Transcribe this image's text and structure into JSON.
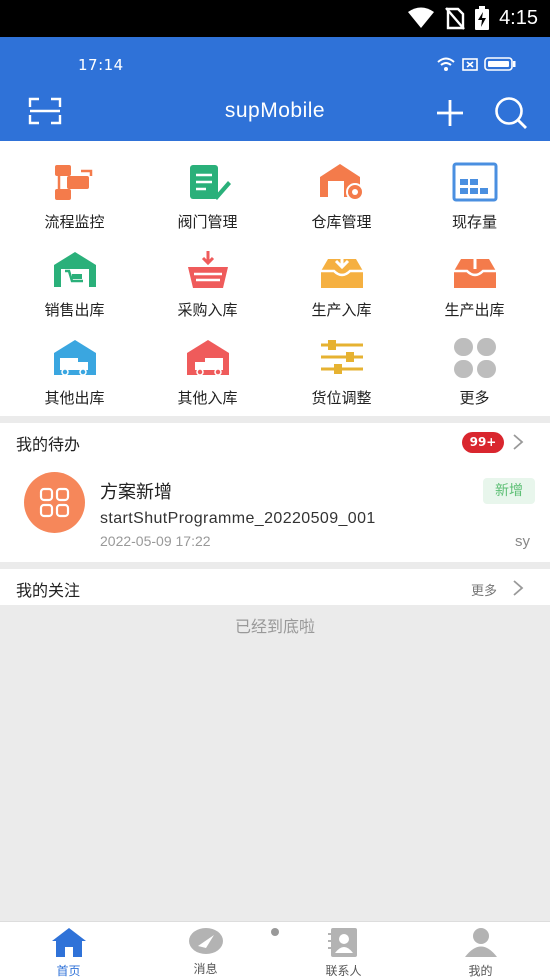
{
  "system": {
    "time": "4:15"
  },
  "app": {
    "inner_time": "17:14",
    "title": "supMobile",
    "icons": {
      "left": "scan-icon",
      "plus": "plus-icon",
      "search": "search-icon"
    }
  },
  "grid": {
    "items": [
      {
        "label": "流程监控",
        "icon": "process-monitor-icon",
        "color": "#f47b4b"
      },
      {
        "label": "阀门管理",
        "icon": "valve-manage-icon",
        "color": "#2ab07a"
      },
      {
        "label": "仓库管理",
        "icon": "warehouse-manage-icon",
        "color": "#f47b4b"
      },
      {
        "label": "现存量",
        "icon": "stock-icon",
        "color": "#4a8fe0"
      },
      {
        "label": "销售出库",
        "icon": "sales-out-icon",
        "color": "#2ab07a"
      },
      {
        "label": "采购入库",
        "icon": "purchase-in-icon",
        "color": "#ef5b5b"
      },
      {
        "label": "生产入库",
        "icon": "production-in-icon",
        "color": "#f5b041"
      },
      {
        "label": "生产出库",
        "icon": "production-out-icon",
        "color": "#f47b4b"
      },
      {
        "label": "其他出库",
        "icon": "other-out-icon",
        "color": "#3aa6e0"
      },
      {
        "label": "其他入库",
        "icon": "other-in-icon",
        "color": "#ef5b5b"
      },
      {
        "label": "货位调整",
        "icon": "location-adjust-icon",
        "color": "#e6b231"
      },
      {
        "label": "更多",
        "icon": "more-icon",
        "color": "#bdbdbd"
      }
    ]
  },
  "todo": {
    "title": "我的待办",
    "badge": "99+",
    "item": {
      "name": "方案新增",
      "code": "startShutProgramme_20220509_001",
      "date": "2022-05-09 17:22",
      "tag": "新增",
      "user": "sy"
    }
  },
  "follow": {
    "title": "我的关注",
    "more": "更多"
  },
  "bottom_message": "已经到底啦",
  "tabs": [
    {
      "label": "首页",
      "icon": "home-icon"
    },
    {
      "label": "消息",
      "icon": "message-icon"
    },
    {
      "label": "联系人",
      "icon": "contacts-icon"
    },
    {
      "label": "我的",
      "icon": "profile-icon"
    }
  ],
  "colors": {
    "primary": "#2f72d8",
    "badge": "#d9262e",
    "avatar": "#f6875a",
    "tag_text": "#5cbf74"
  }
}
